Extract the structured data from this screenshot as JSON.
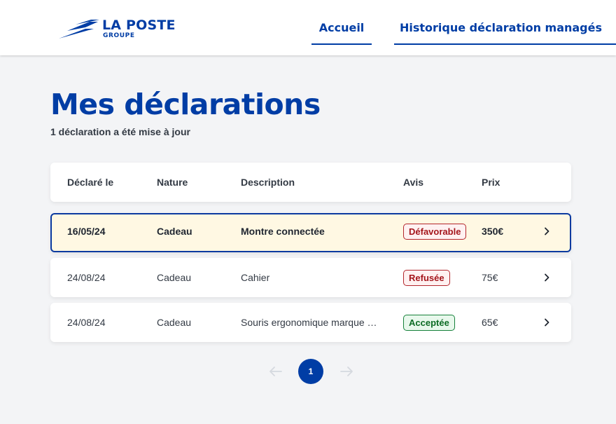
{
  "header": {
    "logo": {
      "main": "LA POSTE",
      "sub": "GROUPE"
    },
    "nav": {
      "home": "Accueil",
      "history": "Historique déclaration managés"
    }
  },
  "main": {
    "title": "Mes déclarations",
    "subtitle": "1 déclaration a été mise à jour",
    "table": {
      "columns": {
        "date": "Déclaré le",
        "nature": "Nature",
        "description": "Description",
        "avis": "Avis",
        "prix": "Prix"
      },
      "rows": [
        {
          "date": "16/05/24",
          "nature": "Cadeau",
          "description": "Montre connectée",
          "avis": "Défavorable",
          "prix": "350€"
        },
        {
          "date": "24/08/24",
          "nature": "Cadeau",
          "description": "Cahier",
          "avis": "Refusée",
          "prix": "75€"
        },
        {
          "date": "24/08/24",
          "nature": "Cadeau",
          "description": "Souris ergonomique marque D...",
          "avis": "Acceptée",
          "prix": "65€"
        }
      ]
    },
    "pagination": {
      "current": "1"
    }
  },
  "colors": {
    "brand_blue": "#003da5",
    "highlight_bg": "#fff8e3",
    "status_red": "#a4151b",
    "status_green": "#0c6b24"
  },
  "icons": {
    "logo": "la-poste-bird-icon",
    "row_arrow": "chevron-right-icon",
    "prev": "arrow-left-icon",
    "next": "arrow-right-icon"
  }
}
